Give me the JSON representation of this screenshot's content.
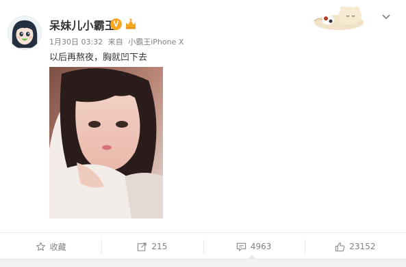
{
  "post": {
    "username": "呆妹儿小霸王",
    "verified_badge": "V",
    "timestamp": "1月30日 03:32",
    "source_prefix": "来自",
    "source_device": "小霸王iPhone X",
    "text": "以后再熬夜，胸就凹下去"
  },
  "actions": {
    "favorite_label": "收藏",
    "repost_count": "215",
    "comment_count": "4963",
    "like_count": "23152"
  },
  "icons": {
    "avatar": "cartoon-avatar-icon",
    "member": "vip-member-icon",
    "decoration": "sleeping-bear-decoration-icon",
    "menu": "chevron-down-icon",
    "favorite": "star-icon",
    "repost": "repost-icon",
    "comment": "comment-icon",
    "like": "thumbs-up-icon"
  },
  "colors": {
    "verified": "#f5a623",
    "text": "#333333",
    "meta": "#808080",
    "border": "#eeeeee"
  }
}
